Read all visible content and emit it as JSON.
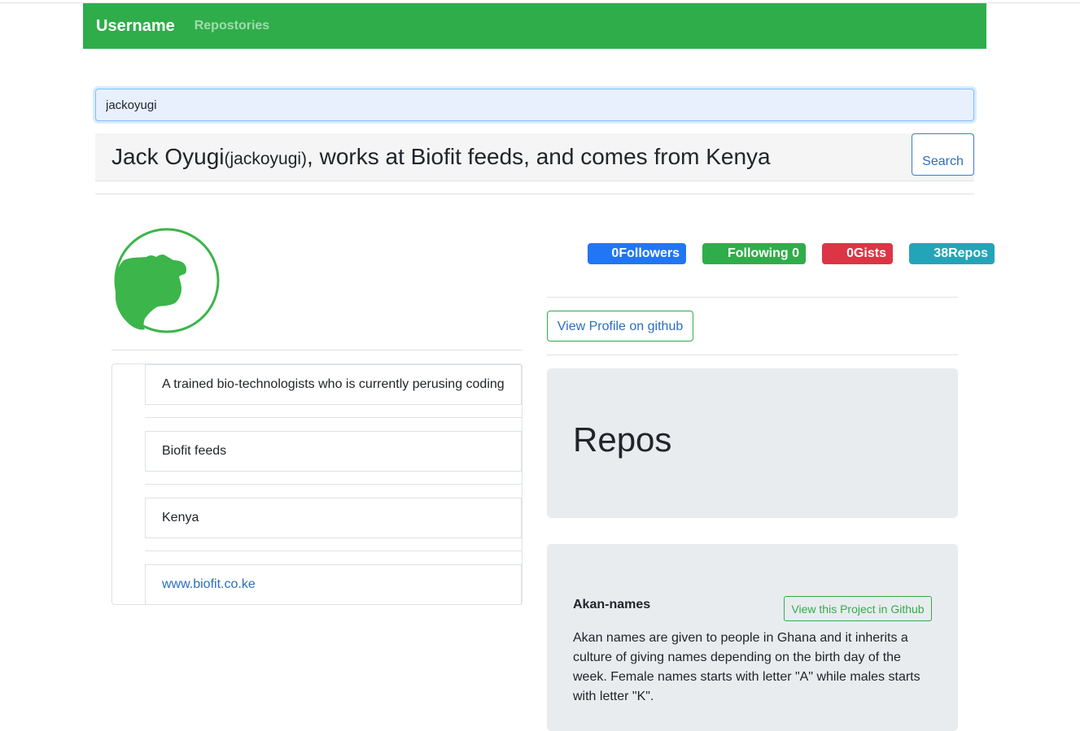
{
  "navbar": {
    "brand": "Username",
    "links": [
      "Repostories"
    ],
    "color": "#2fad4a"
  },
  "search": {
    "value": "jackoyugi",
    "button_label": "Search"
  },
  "headline": {
    "name": "Jack Oyugi",
    "login": "(jackoyugi)",
    "rest": ", works at Biofit feeds, and comes from Kenya"
  },
  "profile": {
    "avatar_icon": "cow-silhouette-icon",
    "bio_items": [
      "A trained bio-technologists who is currently perusing coding",
      "Biofit feeds",
      "Kenya",
      "www.biofit.co.ke"
    ]
  },
  "stats": {
    "followers": "0Followers",
    "following": "Following 0",
    "gists": "0Gists",
    "repos": "38Repos"
  },
  "colors": {
    "followers": "#2176f5",
    "following": "#2fad4a",
    "gists": "#dc3545",
    "repos": "#24a4b8"
  },
  "view_profile_label": "View Profile on github",
  "repos_section": {
    "title": "Repos",
    "items": [
      {
        "name": "Akan-names",
        "button_label": "View this Project in Github",
        "description": "Akan names are given to people in Ghana and it inherits a culture of giving names depending on the birth day of the week. Female names starts with letter \"A\" while males starts with letter \"K\"."
      }
    ]
  }
}
